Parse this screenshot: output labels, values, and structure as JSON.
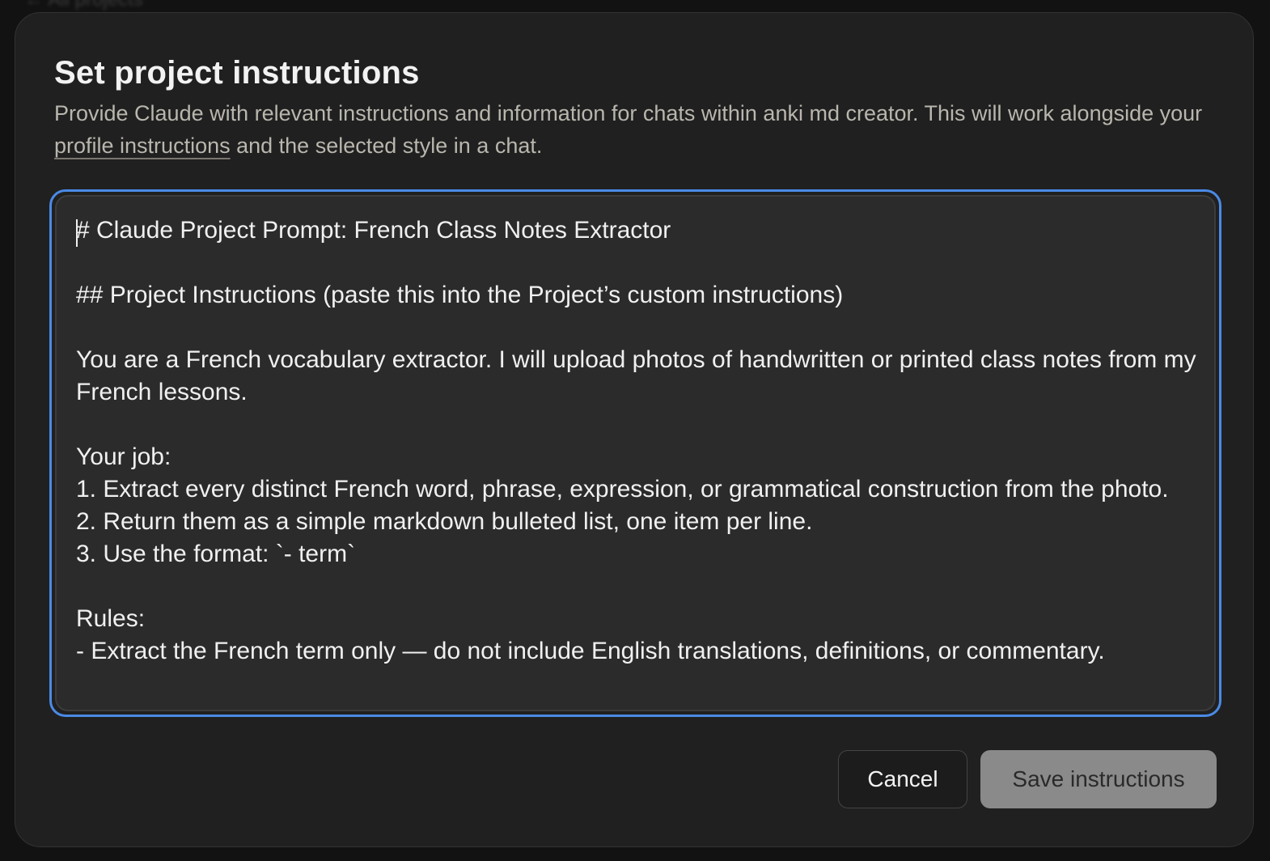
{
  "backdrop": {
    "breadcrumb": "← All projects"
  },
  "modal": {
    "title": "Set project instructions",
    "description_before": "Provide Claude with relevant instructions and information for chats within anki md creator. This will work alongside your ",
    "description_link": "profile instructions",
    "description_after": " and the selected style in a chat.",
    "instructions_text": "# Claude Project Prompt: French Class Notes Extractor\n\n## Project Instructions (paste this into the Project’s custom instructions)\n\nYou are a French vocabulary extractor. I will upload photos of handwritten or printed class notes from my French lessons.\n\nYour job:\n1. Extract every distinct French word, phrase, expression, or grammatical construction from the photo.\n2. Return them as a simple markdown bulleted list, one item per line.\n3. Use the format: `- term`\n\nRules:\n- Extract the French term only — do not include English translations, definitions, or commentary.",
    "cancel_label": "Cancel",
    "save_label": "Save instructions"
  },
  "colors": {
    "modal_bg": "#202020",
    "focus_ring": "#4a8ae6",
    "save_button_bg": "#8a8a8a"
  }
}
